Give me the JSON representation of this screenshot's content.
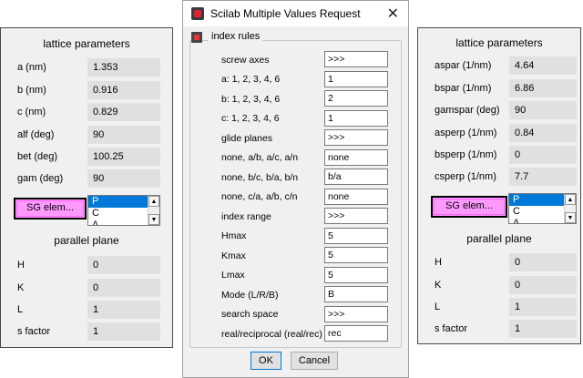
{
  "left_panel": {
    "header": "lattice parameters",
    "rows": [
      {
        "label": "a (nm)",
        "value": "1.353"
      },
      {
        "label": "b (nm)",
        "value": "0.916"
      },
      {
        "label": "c (nm)",
        "value": "0.829"
      },
      {
        "label": "alf (deg)",
        "value": "90"
      },
      {
        "label": "bet (deg)",
        "value": "100.25"
      },
      {
        "label": "gam (deg)",
        "value": "90"
      }
    ],
    "sg_button": "SG elem...",
    "sg_options": [
      "P",
      "C",
      "A"
    ],
    "plane_header": "parallel plane",
    "plane_rows": [
      {
        "label": "H",
        "value": "0"
      },
      {
        "label": "K",
        "value": "0"
      },
      {
        "label": "L",
        "value": "1"
      },
      {
        "label": "s factor",
        "value": "1"
      }
    ]
  },
  "right_panel": {
    "header": "lattice parameters",
    "rows": [
      {
        "label": "aspar (1/nm)",
        "value": "4.64"
      },
      {
        "label": "bspar (1/nm)",
        "value": "6.86"
      },
      {
        "label": "gamspar (deg)",
        "value": "90"
      },
      {
        "label": "asperp (1/nm)",
        "value": "0.84"
      },
      {
        "label": "bsperp (1/nm)",
        "value": "0"
      },
      {
        "label": "csperp (1/nm)",
        "value": "7.7"
      }
    ],
    "sg_button": "SG elem...",
    "sg_options": [
      "P",
      "C",
      "A"
    ],
    "plane_header": "parallel plane",
    "plane_rows": [
      {
        "label": "H",
        "value": "0"
      },
      {
        "label": "K",
        "value": "0"
      },
      {
        "label": "L",
        "value": "1"
      },
      {
        "label": "s factor",
        "value": "1"
      }
    ]
  },
  "dialog": {
    "title": "Scilab Multiple Values Request",
    "close_glyph": "✕",
    "group_title": "index rules",
    "fields": [
      {
        "label": "screw axes",
        "value": ">>>"
      },
      {
        "label": "a: 1, 2, 3, 4, 6",
        "value": "1"
      },
      {
        "label": "b: 1, 2, 3, 4, 6",
        "value": "2"
      },
      {
        "label": "c: 1, 2, 3, 4, 6",
        "value": "1"
      },
      {
        "label": "glide planes",
        "value": ">>>"
      },
      {
        "label": "none, a/b, a/c, a/n",
        "value": "none"
      },
      {
        "label": "none, b/c, b/a, b/n",
        "value": "b/a"
      },
      {
        "label": "none, c/a, a/b, c/n",
        "value": "none"
      },
      {
        "label": "index range",
        "value": ">>>"
      },
      {
        "label": "Hmax",
        "value": "5"
      },
      {
        "label": "Kmax",
        "value": "5"
      },
      {
        "label": "Lmax",
        "value": "5"
      },
      {
        "label": "Mode (L/R/B)",
        "value": "B"
      },
      {
        "label": "search space",
        "value": ">>>"
      },
      {
        "label": "real/reciprocal (real/rec)",
        "value": "rec"
      }
    ],
    "ok_label": "OK",
    "cancel_label": "Cancel"
  }
}
